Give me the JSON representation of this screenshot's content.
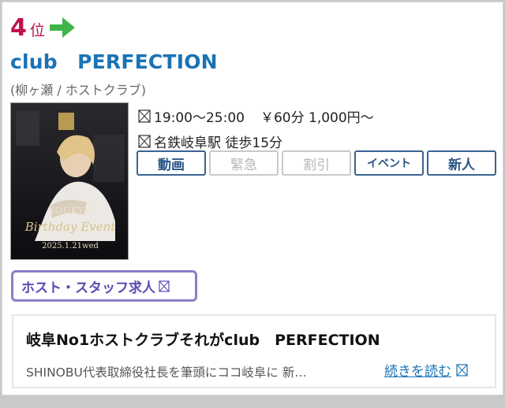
{
  "rank": {
    "number": "4",
    "suffix": "位",
    "trend_icon": "arrow-right-icon",
    "trend_color": "#3fb549"
  },
  "club": {
    "name": "club　PERFECTION",
    "area_genre": "(柳ヶ瀬 / ホストクラブ)",
    "photo_caption_name": "KOUKYO",
    "photo_caption_event": "Birthday Event",
    "photo_caption_date": "2025.1.21wed"
  },
  "info": {
    "hours": "19:00～25:00",
    "price": "￥60分 1,000円～",
    "access": "名鉄岐阜駅 徒歩15分"
  },
  "tags": [
    {
      "label": "動画",
      "active": true
    },
    {
      "label": "緊急",
      "active": false
    },
    {
      "label": "割引",
      "active": false
    },
    {
      "label": "イベント",
      "active": true
    },
    {
      "label": "新人",
      "active": true
    }
  ],
  "recruit": {
    "label": "ホスト・スタッフ求人"
  },
  "description": {
    "title": "岐阜No1ホストクラブそれがclub　PERFECTION",
    "text": "SHINOBU代表取締役社長を筆頭にココ岐阜に 新…",
    "read_more": "続きを読む"
  },
  "colors": {
    "rank": "#c0114b",
    "title": "#1a73b5",
    "tag_border": "#3a6391",
    "recruit_border": "#8b7ec9"
  }
}
